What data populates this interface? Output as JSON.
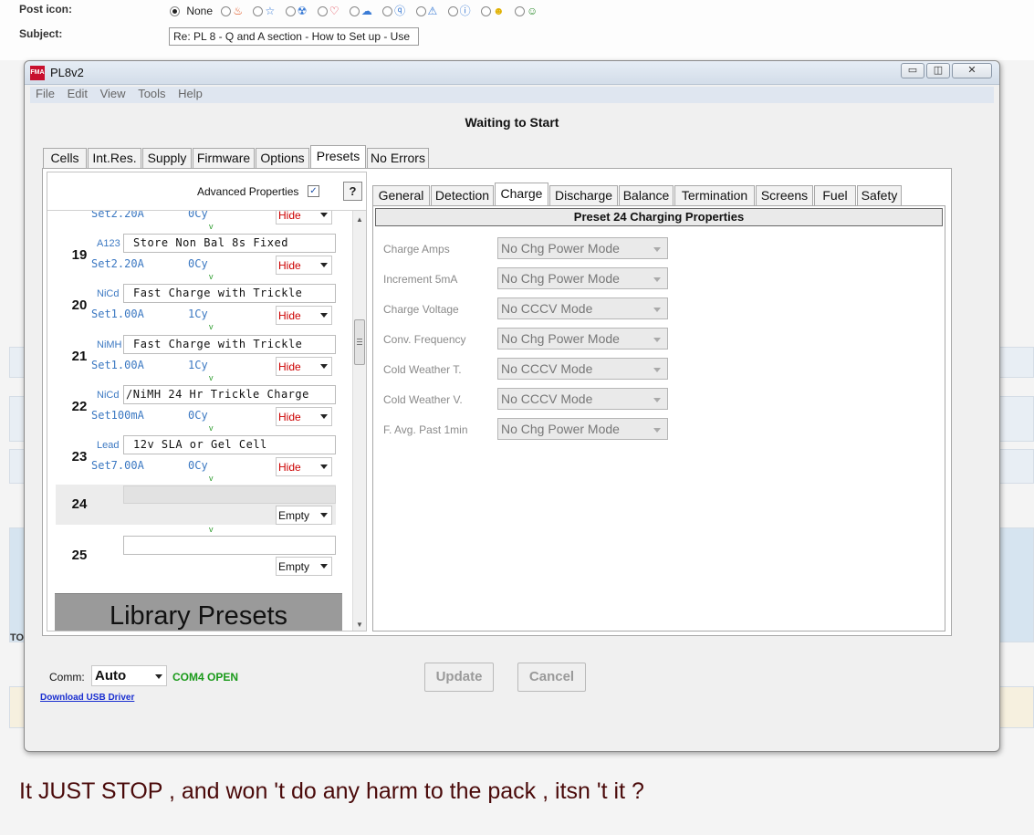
{
  "background": {
    "post_icon_label": "Post icon:",
    "none_label": "None",
    "subject_label": "Subject:",
    "subject_value": "Re: PL 8 - Q and A section - How to Set up - Use",
    "edge_to": "TO",
    "post_text": "It JUST STOP , and won 't do any harm to the pack , itsn 't it ?"
  },
  "window": {
    "title": "PL8v2",
    "logo": "FMA",
    "menu": [
      "File",
      "Edit",
      "View",
      "Tools",
      "Help"
    ],
    "status_title": "Waiting to Start",
    "main_tabs": [
      "Cells",
      "Int.Res.",
      "Supply",
      "Firmware",
      "Options",
      "Presets",
      "No Errors"
    ],
    "active_main_tab": "Presets"
  },
  "presets_panel": {
    "advanced_label": "Advanced Properties",
    "advanced_checked": true,
    "help_label": "?",
    "partial_row": {
      "set": "Set2.20A",
      "cy": "0Cy",
      "visibility": "Hide"
    },
    "rows": [
      {
        "num": "19",
        "chem": "A123",
        "name": "Store   Non Bal 8s Fixed",
        "set": "Set2.20A",
        "cy": "0Cy",
        "visibility": "Hide"
      },
      {
        "num": "20",
        "chem": "NiCd",
        "name": "Fast Charge with Trickle",
        "set": "Set1.00A",
        "cy": "1Cy",
        "visibility": "Hide"
      },
      {
        "num": "21",
        "chem": "NiMH",
        "name": "Fast Charge with Trickle",
        "set": "Set1.00A",
        "cy": "1Cy",
        "visibility": "Hide"
      },
      {
        "num": "22",
        "chem": "NiCd",
        "name": "/NiMH 24 Hr Trickle Charge",
        "set": "Set100mA",
        "cy": "0Cy",
        "visibility": "Hide"
      },
      {
        "num": "23",
        "chem": "Lead",
        "name": "12v SLA or Gel Cell",
        "set": "Set7.00A",
        "cy": "0Cy",
        "visibility": "Hide"
      },
      {
        "num": "24",
        "chem": "",
        "name": "",
        "set": "",
        "cy": "",
        "visibility": "Empty"
      },
      {
        "num": "25",
        "chem": "",
        "name": "",
        "set": "",
        "cy": "",
        "visibility": "Empty"
      }
    ],
    "v_mark": "v",
    "selected_row": "24",
    "library_label": "Library Presets"
  },
  "properties": {
    "sub_tabs": [
      "General",
      "Detection",
      "Charge",
      "Discharge",
      "Balance",
      "Termination",
      "Screens",
      "Fuel",
      "Safety"
    ],
    "active_sub_tab": "Charge",
    "header": "Preset 24  Charging Properties",
    "fields": [
      {
        "label": "Charge Amps",
        "value": "No Chg Power Mode"
      },
      {
        "label": "Increment 5mA",
        "value": "No Chg Power Mode"
      },
      {
        "label": "Charge Voltage",
        "value": "No CCCV Mode"
      },
      {
        "label": "Conv. Frequency",
        "value": "No Chg Power Mode"
      },
      {
        "label": "Cold Weather T.",
        "value": "No CCCV Mode"
      },
      {
        "label": "Cold Weather V.",
        "value": "No CCCV Mode"
      },
      {
        "label": "F. Avg. Past 1min",
        "value": "No Chg Power Mode"
      }
    ]
  },
  "footer": {
    "comm_label": "Comm:",
    "comm_value": "Auto",
    "port_status": "COM4 OPEN",
    "download_link": "Download USB Driver",
    "update_button": "Update",
    "cancel_button": "Cancel"
  },
  "colors": {
    "port_status": "#1a9a1a",
    "hide": "#cc0000",
    "chem_text": "#3b78c2",
    "post_text": "#4a0a0a",
    "library_bg": "#9a9a9a"
  }
}
